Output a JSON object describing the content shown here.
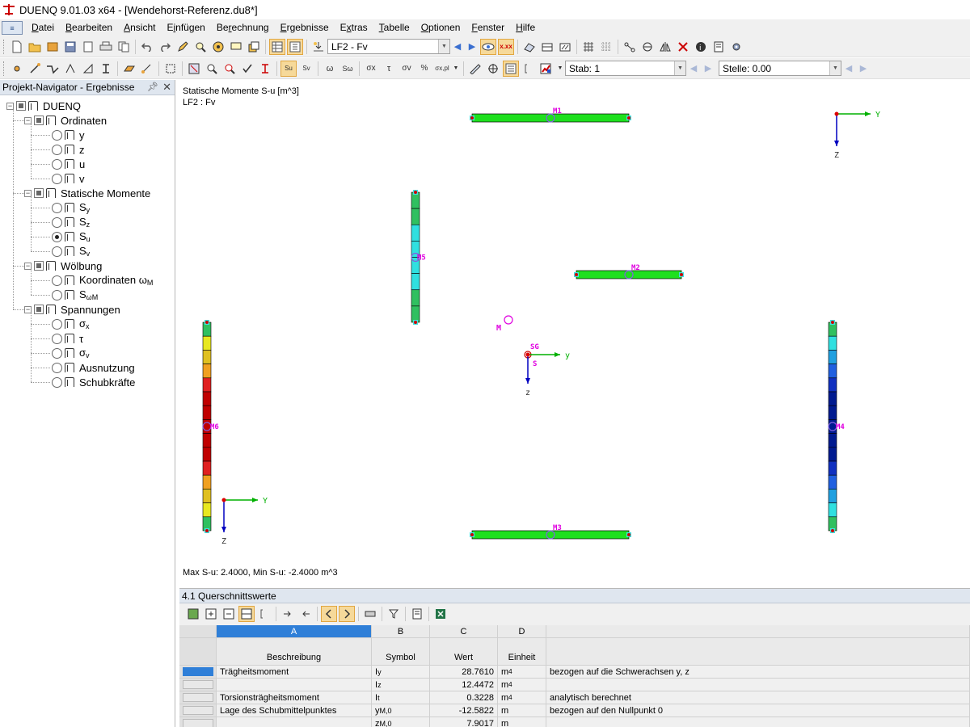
{
  "window": {
    "title": "DUENQ 9.01.03 x64 - [Wendehorst-Referenz.du8*]"
  },
  "menu": {
    "items": [
      {
        "label": "Datei",
        "key": "D"
      },
      {
        "label": "Bearbeiten",
        "key": "B"
      },
      {
        "label": "Ansicht",
        "key": "A"
      },
      {
        "label": "Einfügen",
        "key": "i"
      },
      {
        "label": "Berechnung",
        "key": "r"
      },
      {
        "label": "Ergebnisse",
        "key": "E"
      },
      {
        "label": "Extras",
        "key": "x"
      },
      {
        "label": "Tabelle",
        "key": "T"
      },
      {
        "label": "Optionen",
        "key": "O"
      },
      {
        "label": "Fenster",
        "key": "F"
      },
      {
        "label": "Hilfe",
        "key": "H"
      }
    ]
  },
  "toolbar": {
    "loadcase": "LF2 - Fv",
    "stab_label": "Stab: 1",
    "stelle_label": "Stelle: 0.00",
    "btn_su": "Su",
    "btn_sv": "Sv"
  },
  "navigator": {
    "title": "Projekt-Navigator - Ergebnisse",
    "root": "DUENQ",
    "groups": [
      {
        "label": "Ordinaten",
        "items": [
          "y",
          "z",
          "u",
          "v"
        ]
      },
      {
        "label": "Statische Momente",
        "items": [
          "S",
          "S",
          "S",
          "S"
        ],
        "subs": [
          "y",
          "z",
          "u",
          "v"
        ],
        "selected": 2
      },
      {
        "label": "Wölbung",
        "items": [
          "Koordinaten ω",
          "S"
        ],
        "subs": [
          "M",
          "ωM"
        ]
      },
      {
        "label": "Spannungen",
        "items": [
          "σ",
          "τ",
          "σ",
          "Ausnutzung",
          "Schubkräfte"
        ],
        "subs": [
          "x",
          "",
          "v",
          "",
          ""
        ]
      }
    ]
  },
  "canvas": {
    "result_title": "Statische Momente S-u [m^3]",
    "loadcase_label": "LF2 : Fv",
    "maxmin": "Max S-u: 2.4000, Min S-u: -2.4000 m^3",
    "labels": {
      "m1": "M1",
      "m2": "M2",
      "m3": "M3",
      "m4": "M4",
      "m5": "M5",
      "m6": "M6",
      "shear_center": "M",
      "sg": "SG",
      "s": "S",
      "axis_y": "Y",
      "axis_z": "Z",
      "axis_y_local": "y",
      "axis_z_local": "z"
    },
    "colors": {
      "member_green": "#1ee01e",
      "outline": "#000000",
      "label": "#e000e0",
      "axis_y": "#00b000",
      "axis_z": "#0000c0"
    }
  },
  "panel": {
    "title": "4.1 Querschnittswerte",
    "columns": [
      "A",
      "B",
      "C",
      "D"
    ],
    "headers": [
      "Beschreibung",
      "Symbol",
      "Wert",
      "Einheit",
      ""
    ],
    "rows": [
      {
        "desc": "Trägheitsmoment",
        "sym": "I",
        "symsub": "y",
        "value": "28.7610",
        "unit": "m",
        "unitsup": "4",
        "note": "bezogen auf die Schwerachsen y, z"
      },
      {
        "desc": "",
        "sym": "I",
        "symsub": "z",
        "value": "12.4472",
        "unit": "m",
        "unitsup": "4",
        "note": ""
      },
      {
        "desc": "Torsionsträgheitsmoment",
        "sym": "I",
        "symsub": "t",
        "value": "0.3228",
        "unit": "m",
        "unitsup": "4",
        "note": "analytisch berechnet"
      },
      {
        "desc": "Lage des Schubmittelpunktes",
        "sym": "y",
        "symsub": "M,0",
        "value": "-12.5822",
        "unit": "m",
        "unitsup": "",
        "note": "bezogen auf den Nullpunkt 0"
      },
      {
        "desc": "",
        "sym": "z",
        "symsub": "M,0",
        "value": "7.9017",
        "unit": "m",
        "unitsup": "",
        "note": ""
      }
    ]
  }
}
